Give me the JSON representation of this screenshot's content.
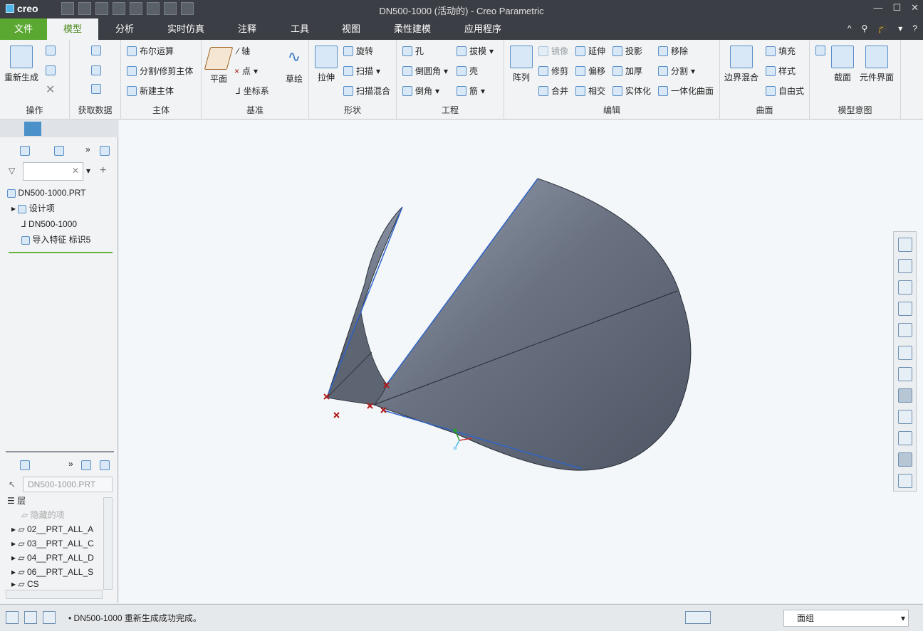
{
  "window": {
    "app_logo": "creo",
    "title": "DN500-1000 (活动的) - Creo Parametric",
    "min": "—",
    "max": "☐",
    "close": "✕"
  },
  "menu": {
    "tabs": [
      "文件",
      "模型",
      "分析",
      "实时仿真",
      "注释",
      "工具",
      "视图",
      "柔性建模",
      "应用程序"
    ],
    "right_icons": [
      "^",
      "⚲",
      "🎓",
      "▾",
      "?"
    ]
  },
  "ribbon": {
    "groups": {
      "operation": {
        "label": "操作",
        "regen": "重新生成"
      },
      "getdata": {
        "label": "获取数据"
      },
      "body": {
        "label": "主体",
        "boolean": "布尔运算",
        "split": "分割/修剪主体",
        "newbody": "新建主体"
      },
      "datum": {
        "label": "基准",
        "plane": "平面",
        "axis": "轴",
        "point": "点",
        "csys": "坐标系",
        "sketch": "草绘"
      },
      "shape": {
        "label": "形状",
        "extrude": "拉伸",
        "revolve": "旋转",
        "sweep": "扫描",
        "sweepblend": "扫描混合"
      },
      "engineering": {
        "label": "工程",
        "hole": "孔",
        "round": "倒圆角",
        "chamfer": "倒角",
        "draft": "拔模",
        "shell": "壳",
        "rib": "筋"
      },
      "editing": {
        "label": "编辑",
        "pattern": "阵列",
        "mirror": "镜像",
        "trim": "修剪",
        "merge": "合并",
        "extend": "延伸",
        "offset": "偏移",
        "intersect": "相交",
        "project": "投影",
        "thicken": "加厚",
        "solidify": "实体化",
        "remove": "移除",
        "splitsurf": "分割",
        "unify": "一体化曲面"
      },
      "surfaces": {
        "label": "曲面",
        "boundary": "边界混合",
        "fill": "填充",
        "style": "样式",
        "freestyle": "自由式"
      },
      "intent": {
        "label": "模型意图",
        "section": "截面",
        "compiface": "元件界面"
      }
    }
  },
  "model_tree": {
    "search_placeholder": "",
    "items": [
      {
        "label": "DN500-1000.PRT"
      },
      {
        "label": "设计项"
      },
      {
        "label": "DN500-1000"
      },
      {
        "label": "导入特征 标识5"
      }
    ]
  },
  "layer_tree": {
    "model_select": "DN500-1000.PRT",
    "header": "层",
    "items": [
      {
        "label": "隐藏的项"
      },
      {
        "label": "02__PRT_ALL_A"
      },
      {
        "label": "03__PRT_ALL_C"
      },
      {
        "label": "04__PRT_ALL_D"
      },
      {
        "label": "06__PRT_ALL_S"
      },
      {
        "label": "CS"
      }
    ]
  },
  "status": {
    "message": "• DN500-1000 重新生成成功完成。",
    "filter_value": "面组"
  },
  "colors": {
    "title_bg": "#3b3f45",
    "file_tab": "#5aa832",
    "active_tab_text": "#4d8a1e",
    "surface": "#5b6270",
    "edge_highlight": "#2f64c8",
    "vertex_marker": "#b11a1a"
  }
}
